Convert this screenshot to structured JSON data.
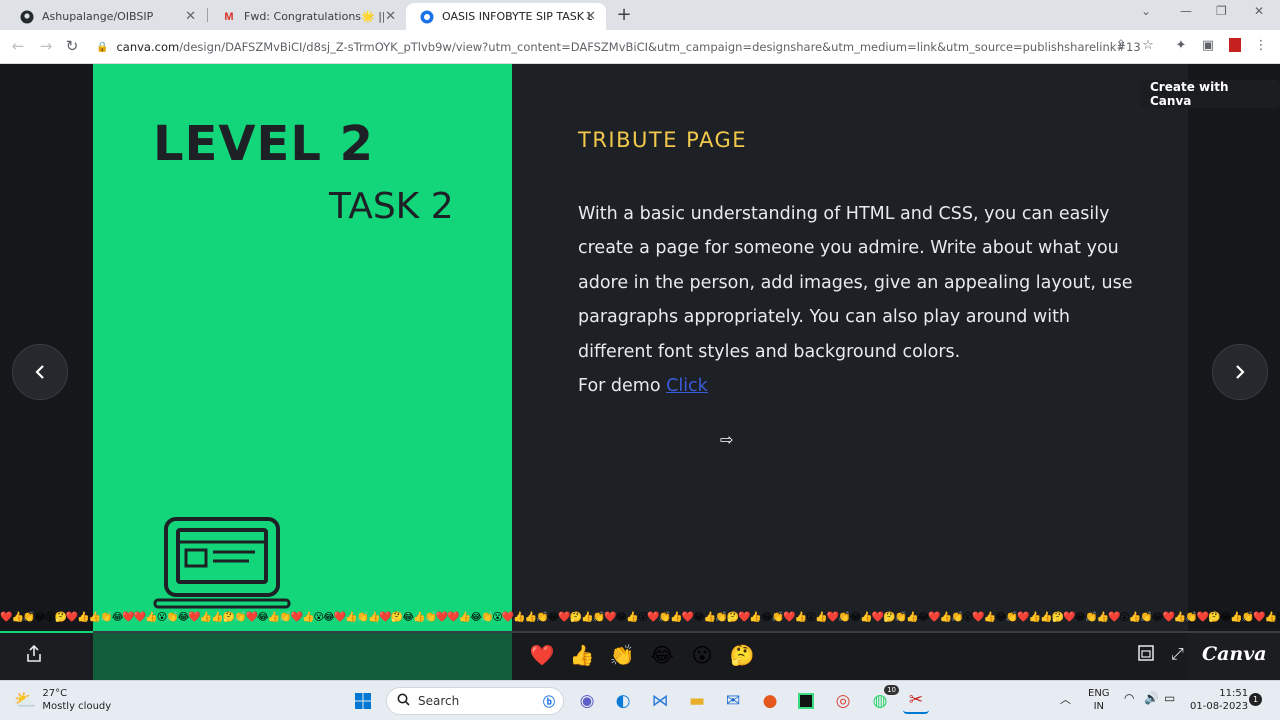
{
  "browser": {
    "tabs": [
      {
        "title": "Ashupalange/OIBSIP",
        "icon": "github-icon",
        "active": false
      },
      {
        "title": "Fwd: Congratulations🌟 || Offer",
        "icon": "gmail-icon",
        "active": false
      },
      {
        "title": "OASIS INFOBYTE SIP TASK LIST",
        "icon": "canva-icon",
        "active": true
      }
    ],
    "new_tab_label": "+",
    "url_host": "canva.com",
    "url_path": "/design/DAFSZMvBiCI/d8sj_Z-sTrmOYK_pTlvb9w/view?utm_content=DAFSZMvBiCI&utm_campaign=designshare&utm_medium=link&utm_source=publishsharelink#13"
  },
  "canva": {
    "create_button": "Create with Canva",
    "logo": "Canva",
    "reactions": [
      "❤️",
      "👍",
      "👏",
      "😂",
      "😮",
      "🤔"
    ]
  },
  "slide": {
    "level": "LEVEL 2",
    "task": "TASK 2",
    "title": "TRIBUTE PAGE",
    "body": "With a basic understanding of HTML and CSS, you can easily create a page for someone you admire. Write about what you adore in the person, add images, give an appealing layout, use paragraphs appropriately. You can also play around with different font styles and background colors.",
    "demo_prefix": "For demo ",
    "demo_link": "Click"
  },
  "taskbar": {
    "weather_temp": "27°C",
    "weather_desc": "Mostly cloudy",
    "search_placeholder": "Search",
    "lang_1": "ENG",
    "lang_2": "IN",
    "time": "11:51",
    "date": "01-08-2023",
    "whatsapp_badge": "10",
    "notification_count": "1"
  },
  "colors": {
    "slide_green": "#13d57a",
    "slide_dark": "#1d2125",
    "title_yellow": "#f2c94c",
    "link_blue": "#3b5bdb"
  }
}
